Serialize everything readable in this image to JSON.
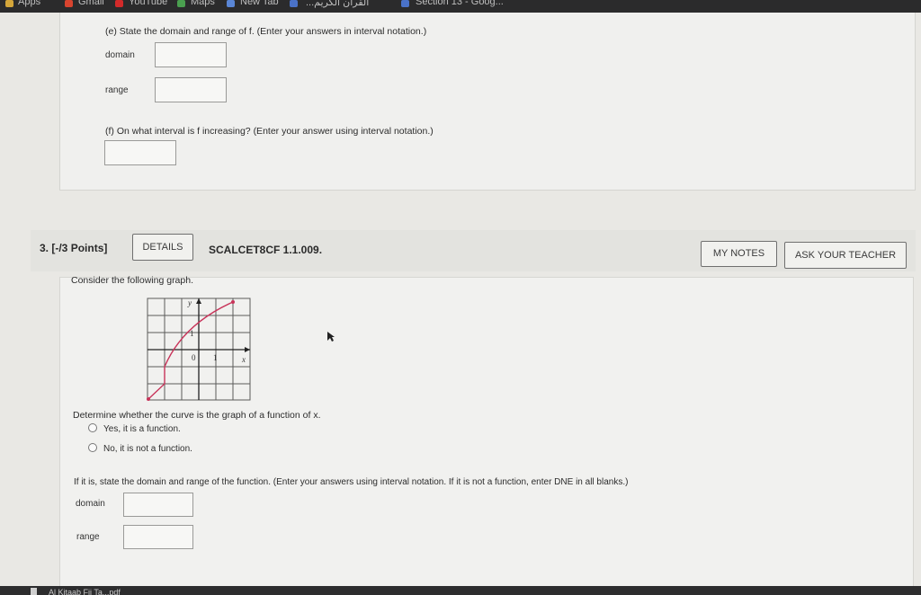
{
  "bookmarks": [
    {
      "label": "Apps",
      "icon": "apps-grid-icon",
      "color": "#d4a63a"
    },
    {
      "label": "Gmail",
      "icon": "gmail-icon",
      "color": "#d8442f"
    },
    {
      "label": "YouTube",
      "icon": "youtube-icon",
      "color": "#d22a2a"
    },
    {
      "label": "Maps",
      "icon": "maps-icon",
      "color": "#4a9f4f"
    },
    {
      "label": "New Tab",
      "icon": "new-tab-icon",
      "color": "#5a86d6"
    },
    {
      "label": "...القرآن الكريم",
      "icon": "bookmark-icon",
      "color": "#4a72c8"
    },
    {
      "label": "Section 13 - Goog...",
      "icon": "bookmark-icon",
      "color": "#4a72c8"
    }
  ],
  "part_e": {
    "question": "(e) State the domain and range of f. (Enter your answers in interval notation.)",
    "domain_label": "domain",
    "domain_value": "",
    "range_label": "range",
    "range_value": ""
  },
  "part_f": {
    "question": "(f) On what interval is f increasing? (Enter your answer using interval notation.)",
    "answer_value": ""
  },
  "q3": {
    "number": "3.",
    "points": "[-/3 Points]",
    "details_label": "DETAILS",
    "code": "SCALCET8CF 1.1.009.",
    "my_notes_label": "MY NOTES",
    "ask_teacher_label": "ASK YOUR TEACHER",
    "prompt": "Consider the following graph.",
    "graph_labels": {
      "y": "y",
      "one": "1",
      "zero": "0",
      "x_one": "1",
      "x": "x"
    },
    "determine": "Determine whether the curve is the graph of a function of x.",
    "options": [
      "Yes, it is a function.",
      "No, it is not a function."
    ],
    "selected_option": null,
    "if_it_is": "If it is, state the domain and range of the function. (Enter your answers using interval notation. If it is not a function, enter DNE in all blanks.)",
    "domain_label": "domain",
    "domain_value": "",
    "range_label": "range",
    "range_value": ""
  },
  "taskbar": {
    "label": "Al Kitaab Fii Ta...pdf"
  },
  "colors": {
    "curve": "#c8345a",
    "grid": "#5a5a5a"
  }
}
